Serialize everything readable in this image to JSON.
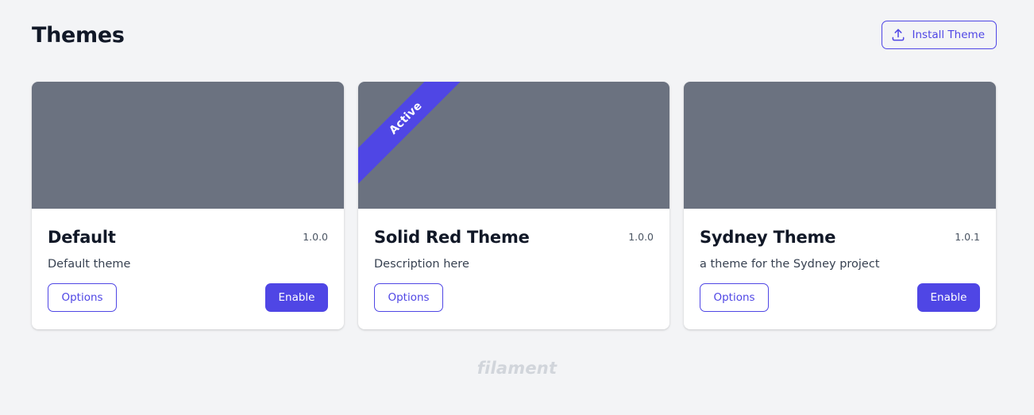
{
  "header": {
    "title": "Themes",
    "install_label": "Install Theme"
  },
  "icons": {
    "install": "upload-icon"
  },
  "colors": {
    "accent": "#4f46e5",
    "preview": "#6b7280",
    "background": "#f3f4f6"
  },
  "themes": [
    {
      "name": "Default",
      "version": "1.0.0",
      "description": "Default theme",
      "options_label": "Options",
      "enable_label": "Enable",
      "active": false
    },
    {
      "name": "Solid Red Theme",
      "version": "1.0.0",
      "description": "Description here",
      "options_label": "Options",
      "active_label": "Active",
      "active": true
    },
    {
      "name": "Sydney Theme",
      "version": "1.0.1",
      "description": "a theme for the Sydney project",
      "options_label": "Options",
      "enable_label": "Enable",
      "active": false
    }
  ],
  "footer": {
    "brand": "filament"
  }
}
